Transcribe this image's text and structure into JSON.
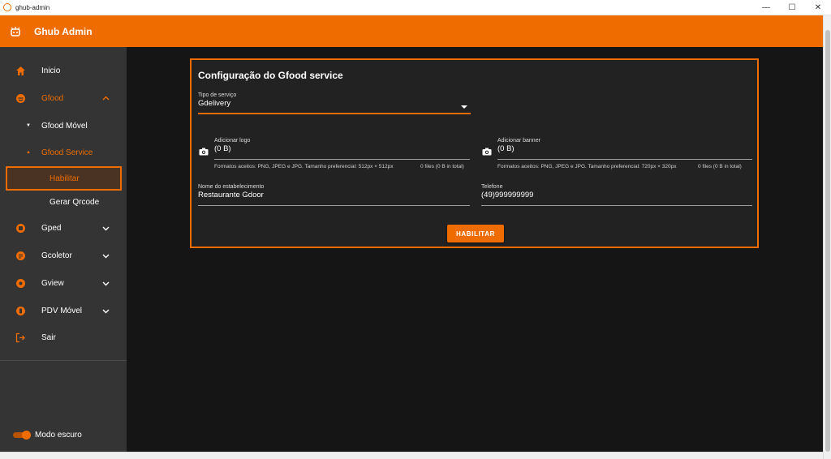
{
  "window": {
    "title": "ghub-admin",
    "controls": {
      "minimize": "—",
      "maximize": "☐",
      "close": "✕"
    }
  },
  "appbar": {
    "title": "Ghub Admin",
    "logo_icon": "robot-icon"
  },
  "sidebar": {
    "items": [
      {
        "label": "Inicio",
        "icon": "home-icon"
      },
      {
        "label": "Gfood",
        "icon": "gfood-icon",
        "expanded": true
      },
      {
        "label": "Gfood Móvel",
        "sub": true,
        "expanded": false
      },
      {
        "label": "Gfood Service",
        "sub": true,
        "expanded": true
      },
      {
        "label": "Habilitar",
        "active": true
      },
      {
        "label": "Gerar Qrcode"
      },
      {
        "label": "Gped",
        "icon": "gped-icon"
      },
      {
        "label": "Gcoletor",
        "icon": "gcoletor-icon"
      },
      {
        "label": "Gview",
        "icon": "gview-icon"
      },
      {
        "label": "PDV Móvel",
        "icon": "pdv-icon"
      },
      {
        "label": "Sair",
        "icon": "logout-icon"
      }
    ],
    "dark_mode_label": "Modo escuro",
    "dark_mode_on": true
  },
  "form": {
    "title": "Configuração do Gfood service",
    "service_type": {
      "label": "Tipo de serviço",
      "value": "Gdelivery"
    },
    "logo": {
      "label": "Adicionar logo",
      "value": "(0 B)",
      "hint": "Formatos aceitos: PNG, JPEG e JPG. Tamanho preferencial: 512px × 512px",
      "count": "0 files (0 B in total)"
    },
    "banner": {
      "label": "Adicionar banner",
      "value": "(0 B)",
      "hint": "Formatos aceitos: PNG, JPEG e JPG. Tamanho preferencial: 720px × 320px",
      "count": "0 files (0 B in total)"
    },
    "name": {
      "label": "Nome do estabelecimento",
      "value": "Restaurante Gdoor"
    },
    "phone": {
      "label": "Telefone",
      "value": "(49)999999999"
    },
    "submit_label": "HABILITAR"
  },
  "colors": {
    "accent": "#ef6c00",
    "sidebar_bg": "#343434",
    "content_bg": "#151515",
    "card_bg": "#222222"
  }
}
